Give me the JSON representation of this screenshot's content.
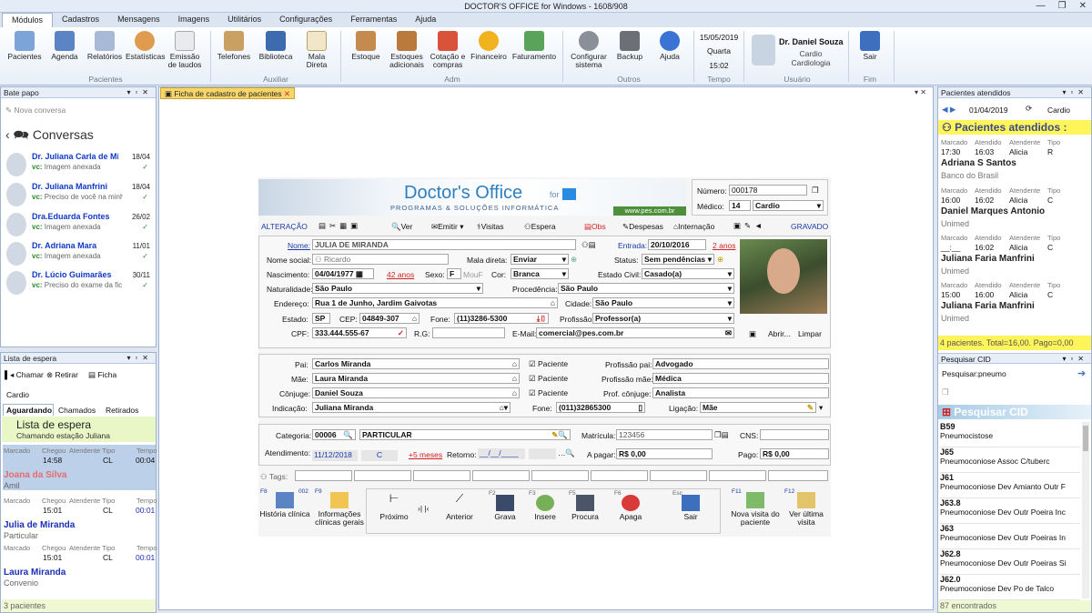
{
  "window": {
    "title": "DOCTOR'S OFFICE for Windows - 1608/908"
  },
  "menu_tabs": [
    "Módulos",
    "Cadastros",
    "Mensagens",
    "Imagens",
    "Utilitários",
    "Configurações",
    "Ferramentas",
    "Ajuda"
  ],
  "ribbon": {
    "pacientes_group": {
      "label": "Pacientes",
      "buttons": [
        "Pacientes",
        "Agenda",
        "Relatórios",
        "Estatísticas",
        "Emissão\nde laudos"
      ]
    },
    "auxiliar_group": {
      "label": "Auxiliar",
      "buttons": [
        "Telefones",
        "Biblioteca",
        "Mala\nDireta"
      ]
    },
    "adm_group": {
      "label": "Adm",
      "buttons": [
        "Estoque",
        "Estoques\nadicionais",
        "Cotação e\ncompras",
        "Financeiro",
        "Faturamento"
      ]
    },
    "outros_group": {
      "label": "Outros",
      "buttons": [
        "Configurar\nsistema",
        "Backup",
        "Ajuda"
      ]
    },
    "tempo": {
      "label": "Tempo",
      "date": "15/05/2019",
      "weekday": "Quarta",
      "time": "15:02"
    },
    "usuario": {
      "label": "Usuário",
      "name": "Dr. Daniel Souza",
      "role": "Cardio",
      "specialty": "Cardiologia"
    },
    "fim": {
      "label": "Fim",
      "button": "Sair"
    }
  },
  "chat": {
    "panel_title": "Bate papo",
    "new_conv": "Nova conversa",
    "title": "Conversas",
    "items": [
      {
        "name": "Dr. Juliana Carla de Mi",
        "date": "18/04",
        "msg": "Imagem anexada",
        "prefix": "vc:"
      },
      {
        "name": "Dr. Juliana Manfrini",
        "date": "18/04",
        "msg": "Preciso de você na minh",
        "prefix": "vc:"
      },
      {
        "name": "Dra.Eduarda Fontes",
        "date": "26/02",
        "msg": "Imagem anexada",
        "prefix": "vc:"
      },
      {
        "name": "Dr. Adriana Mara",
        "date": "11/01",
        "msg": "Imagem anexada",
        "prefix": "vc:"
      },
      {
        "name": "Dr. Lúcio Guimarães",
        "date": "30/11",
        "msg": "Preciso do exame da fic",
        "prefix": "vc:"
      }
    ]
  },
  "waitlist": {
    "panel_title": "Lista de espera",
    "call": "Chamar",
    "remove": "Retirar",
    "sheet": "Ficha",
    "specialty": "Cardio",
    "tabs": [
      "Aguardando",
      "Chamados",
      "Retirados"
    ],
    "heading": "Lista de espera",
    "subheading": "Chamando estação Juliana",
    "cols": [
      "Marcado",
      "Chegou",
      "Atendente",
      "Tipo",
      "Tempo"
    ],
    "items": [
      {
        "chegou": "14:58",
        "tipo": "CL",
        "tempo": "00:04",
        "name": "Joana da Silva",
        "sub": "Amil"
      },
      {
        "chegou": "15:01",
        "tipo": "CL",
        "tempo": "00:01",
        "name": "Julia de Miranda",
        "sub": "Particular"
      },
      {
        "chegou": "15:01",
        "tipo": "CL",
        "tempo": "00:01",
        "name": "Laura Miranda",
        "sub": "Convenio"
      }
    ],
    "footer": "3 pacientes"
  },
  "document": {
    "tab": "Ficha de cadastro de pacientes",
    "logo": {
      "title": "Doctor's Office",
      "for": "for",
      "subtitle": "Programas & Soluções Informática",
      "url": "www.pes.com.br"
    },
    "numero_label": "Número:",
    "numero": "000178",
    "medico_label": "Médico:",
    "medico_num": "14",
    "medico": "Cardio",
    "mode": "ALTERAÇÃO",
    "status": "GRAVADO",
    "toolbar": [
      "Ver",
      "Emitir",
      "Visitas",
      "Espera",
      "Obs",
      "Despesas",
      "Internação"
    ],
    "fields": {
      "nome_label": "Nome:",
      "nome": "JULIA DE MIRANDA",
      "entrada_label": "Entrada:",
      "entrada": "20/10/2016",
      "entrada_anos": "2 anos",
      "nome_social_label": "Nome social:",
      "nome_social": "Ricardo",
      "mala_label": "Mala direta:",
      "mala": "Enviar",
      "status_label": "Status:",
      "status": "Sem pendências",
      "nasc_label": "Nascimento:",
      "nasc": "04/04/1977",
      "idade": "42 anos",
      "sexo_label": "Sexo:",
      "sexo": "F",
      "sexo_hint": "MouF",
      "cor_label": "Cor:",
      "cor": "Branca",
      "civil_label": "Estado Civil:",
      "civil": "Casado(a)",
      "nat_label": "Naturalidade:",
      "nat": "São Paulo",
      "proc_label": "Procedência:",
      "proc": "São Paulo",
      "end_label": "Endereço:",
      "end": "Rua 1 de Junho, Jardim Gaivotas",
      "cid_label": "Cidade:",
      "cid": "São Paulo",
      "uf_label": "Estado:",
      "uf": "SP",
      "cep_label": "CEP:",
      "cep": "04849-307",
      "fone_label": "Fone:",
      "fone": "(11)3286-5300",
      "prof_label": "Profissão:",
      "prof": "Professor(a)",
      "cpf_label": "CPF:",
      "cpf": "333.444.555-67",
      "rg_label": "R.G:",
      "rg": "",
      "email_label": "E-Mail:",
      "email": "comercial@pes.com.br",
      "abrir": "Abrir...",
      "limpar": "Limpar"
    },
    "family": {
      "pai_label": "Pai:",
      "pai": "Carlos Miranda",
      "mae_label": "Mãe:",
      "mae": "Laura Miranda",
      "conj_label": "Cônjuge:",
      "conj": "Daniel Souza",
      "paciente": "Paciente",
      "prof_pai_label": "Profissão pai:",
      "prof_pai": "Advogado",
      "prof_mae_label": "Profissão mãe:",
      "prof_mae": "Médica",
      "prof_conj_label": "Prof. cônjuge:",
      "prof_conj": "Analista",
      "ind_label": "Indicação:",
      "ind": "Juliana Miranda",
      "ind_fone_label": "Fone:",
      "ind_fone": "(011)32865300",
      "lig_label": "Ligação:",
      "lig": "Mãe"
    },
    "billing": {
      "cat_label": "Categoria:",
      "cat_code": "00006",
      "cat": "PARTICULAR",
      "mat_label": "Matrícula:",
      "mat": "123456",
      "cns_label": "CNS:",
      "cns": "",
      "atend_label": "Atendimento:",
      "atend": "11/12/2018",
      "atend_tipo": "C",
      "atend_meses": "+5 meses",
      "ret_label": "Retorno:",
      "ret": "__/__/____",
      "apagar_label": "A pagar:",
      "apagar": "R$ 0,00",
      "pago_label": "Pago:",
      "pago": "R$ 0,00",
      "tags_label": "Tags:"
    },
    "bottom_buttons": {
      "historia": "História clínica",
      "info": "Informações\nclínicas gerais",
      "proximo": "Próximo",
      "anterior": "Anterior",
      "grava": "Grava",
      "insere": "Insere",
      "procura": "Procura",
      "apaga": "Apaga",
      "sair": "Sair",
      "nova": "Nova visita do\npaciente",
      "ver": "Ver última\nvisita",
      "keys": {
        "f8": "F8",
        "f9": "F9",
        "f2": "F2",
        "f3": "F3",
        "f5": "F5",
        "f6": "F6",
        "esc": "Esc",
        "f11": "F11",
        "f12": "F12",
        "k002": "002"
      }
    }
  },
  "attended": {
    "panel_title": "Pacientes atendidos",
    "date": "01/04/2019",
    "specialty": "Cardio",
    "heading": "Pacientes atendidos :",
    "cols": [
      "Marcado",
      "Atendido",
      "Atendente",
      "Tipo"
    ],
    "items": [
      {
        "marcado": "17:30",
        "atendido": "16:03",
        "atendente": "Alicia",
        "tipo": "R",
        "name": "Adriana S Santos",
        "sub": "Banco do Brasil"
      },
      {
        "marcado": "16:00",
        "atendido": "16:02",
        "atendente": "Alicia",
        "tipo": "C",
        "name": "Daniel Marques Antonio",
        "sub": "Unimed"
      },
      {
        "marcado": "__:__",
        "atendido": "16:02",
        "atendente": "Alicia",
        "tipo": "C",
        "name": "Juliana Faria Manfrini",
        "sub": "Unimed"
      },
      {
        "marcado": "15:00",
        "atendido": "16:00",
        "atendente": "Alicia",
        "tipo": "C",
        "name": "Juliana Faria Manfrini",
        "sub": "Unimed"
      }
    ],
    "footer": "4 pacientes. Total=16,00. Pago=0,00"
  },
  "cid": {
    "panel_title": "Pesquisar CID",
    "search_label": "Pesquisar:",
    "search": "pneumo",
    "heading": "Pesquisar CID",
    "items": [
      {
        "code": "B59",
        "desc": "Pneumocistose"
      },
      {
        "code": "J65",
        "desc": "Pneumoconiose Assoc C/tuberc"
      },
      {
        "code": "J61",
        "desc": "Pneumoconiose Dev Amianto Outr F"
      },
      {
        "code": "J63.8",
        "desc": "Pneumoconiose Dev Outr Poeira Inc"
      },
      {
        "code": "J63",
        "desc": "Pneumoconiose Dev Outr Poeiras In"
      },
      {
        "code": "J62.8",
        "desc": "Pneumoconiose Dev Outr Poeiras Si"
      },
      {
        "code": "J62.0",
        "desc": "Pneumoconiose Dev Po de Talco"
      }
    ],
    "footer": "87 encontrados"
  }
}
